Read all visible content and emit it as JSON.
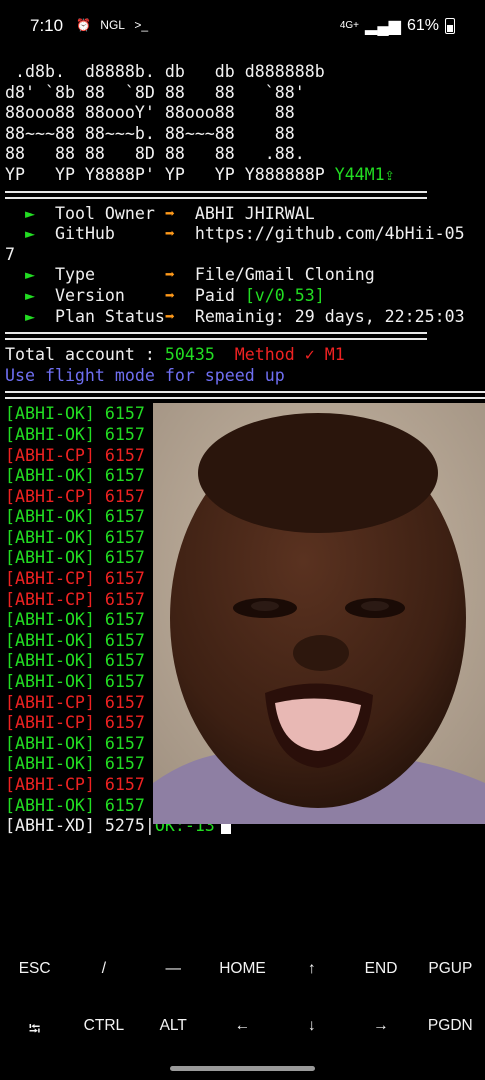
{
  "status_bar": {
    "time": "7:10",
    "notif_icons": [
      "alarm-off-icon",
      "NGL",
      ">_"
    ],
    "network": "4G+",
    "battery": "61%"
  },
  "banner": [
    " .d8b.  d8888b. db   db d888888b",
    "d8' `8b 88  `8D 88   88   `88'",
    "88ooo88 88oooY' 88ooo88    88",
    "88~~~88 88~~~b. 88~~~88    88",
    "88   88 88   8D 88   88   .88.",
    "YP   YP Y8888P' YP   YP Y888888P"
  ],
  "banner_tag": "Y44M1",
  "info": {
    "owner_label": "Tool Owner",
    "owner": "ABHI JHIRWAL",
    "github_label": "GitHub",
    "github": "https://github.com/4bHii-05",
    "github_wrap": "7",
    "type_label": "Type",
    "type": "File/Gmail Cloning",
    "version_label": "Version",
    "version_prefix": "Paid ",
    "version": "[v/0.53]",
    "plan_label": "Plan Status",
    "plan": "Remainig: 29 days, 22:25:03"
  },
  "stats": {
    "total_label": "Total account : ",
    "total": "50435",
    "method": "Method ✓ M1",
    "tip": "Use flight mode for speed up"
  },
  "results": [
    {
      "tag": "[ABHI-OK] 6157",
      "status": "ok"
    },
    {
      "tag": "[ABHI-OK] 6157",
      "status": "ok"
    },
    {
      "tag": "[ABHI-CP] 6157",
      "status": "cp"
    },
    {
      "tag": "[ABHI-OK] 6157",
      "status": "ok"
    },
    {
      "tag": "[ABHI-CP] 6157",
      "status": "cp"
    },
    {
      "tag": "[ABHI-OK] 6157",
      "status": "ok"
    },
    {
      "tag": "[ABHI-OK] 6157",
      "status": "ok"
    },
    {
      "tag": "[ABHI-OK] 6157",
      "status": "ok"
    },
    {
      "tag": "[ABHI-CP] 6157",
      "status": "cp"
    },
    {
      "tag": "[ABHI-CP] 6157",
      "status": "cp"
    },
    {
      "tag": "[ABHI-OK] 6157",
      "status": "ok"
    },
    {
      "tag": "[ABHI-OK] 6157",
      "status": "ok"
    },
    {
      "tag": "[ABHI-OK] 6157",
      "status": "ok"
    },
    {
      "tag": "[ABHI-OK] 6157",
      "status": "ok"
    },
    {
      "tag": "[ABHI-CP] 6157",
      "status": "cp"
    },
    {
      "tag": "[ABHI-CP] 6157",
      "status": "cp"
    },
    {
      "tag": "[ABHI-OK] 6157",
      "status": "ok"
    },
    {
      "tag": "[ABHI-OK] 6157",
      "status": "ok"
    },
    {
      "tag": "[ABHI-CP] 6157",
      "status": "cp"
    },
    {
      "tag": "[ABHI-OK] 6157",
      "status": "ok"
    }
  ],
  "progress": {
    "prefix": "[ABHI-XD] 5275|",
    "ok": "OK:-13"
  },
  "extra_keys": {
    "row1": [
      "ESC",
      "/",
      "—",
      "HOME",
      "↑",
      "END",
      "PGUP"
    ],
    "row2": [
      "⭾",
      "CTRL",
      "ALT",
      "←",
      "↓",
      "→",
      "PGDN"
    ]
  },
  "colors": {
    "ok": "#22dd22",
    "cp": "#ee2222",
    "arrow": "#ff9a1a",
    "tip": "#6f6ff2"
  }
}
